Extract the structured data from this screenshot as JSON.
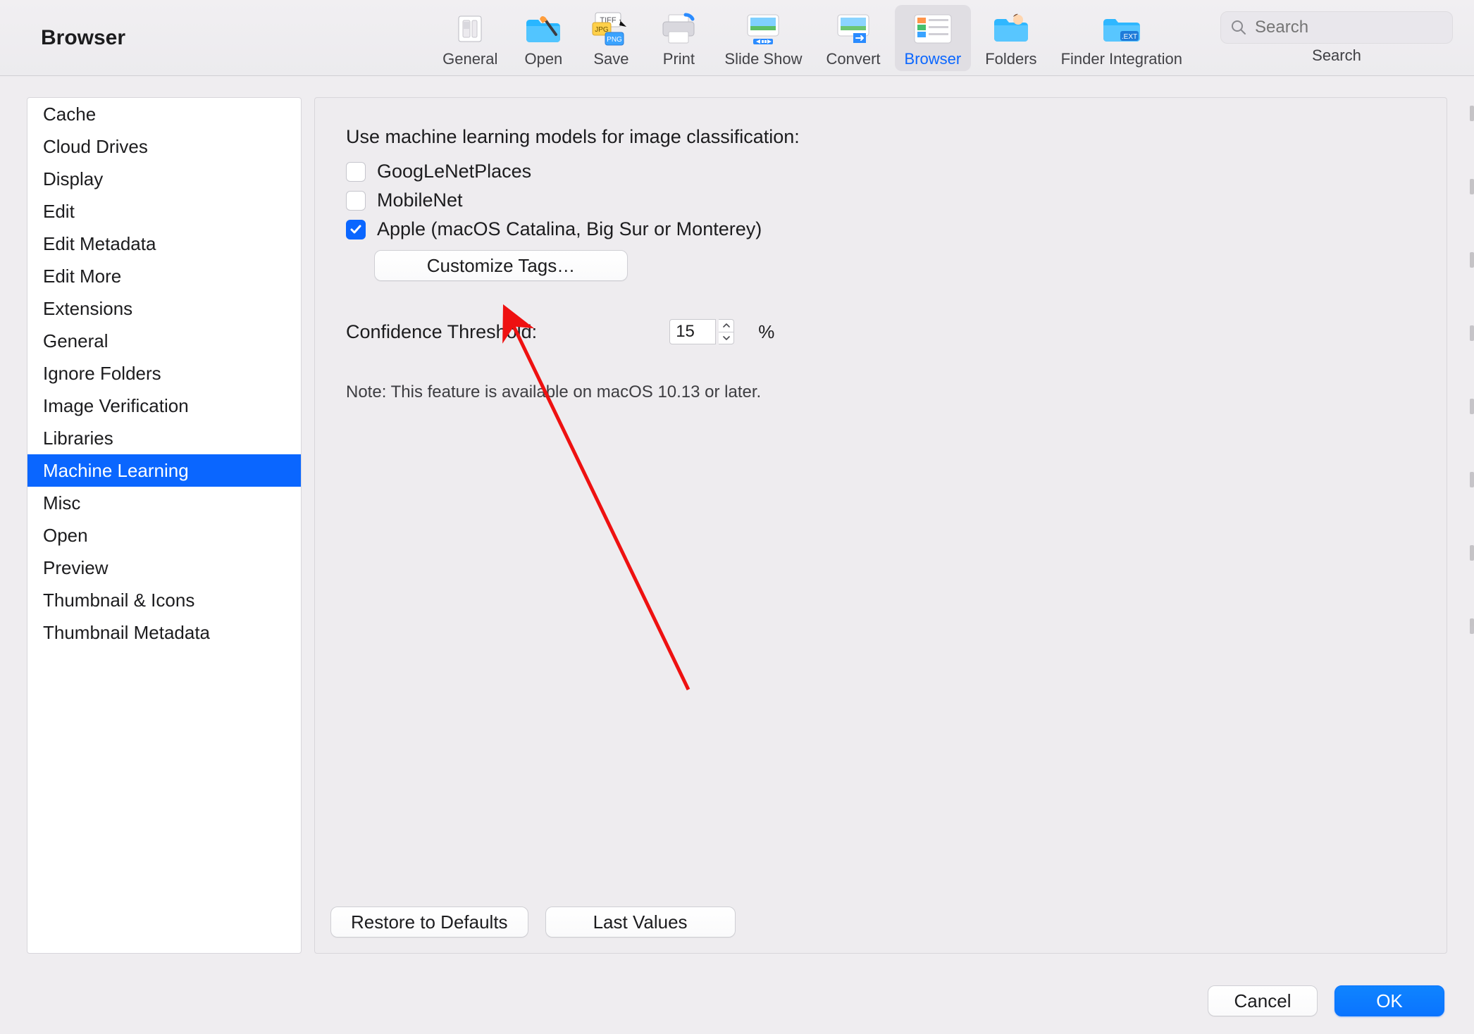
{
  "window": {
    "title": "Browser"
  },
  "toolbar": {
    "items": [
      {
        "label": "General"
      },
      {
        "label": "Open"
      },
      {
        "label": "Save"
      },
      {
        "label": "Print"
      },
      {
        "label": "Slide Show"
      },
      {
        "label": "Convert"
      },
      {
        "label": "Browser"
      },
      {
        "label": "Folders"
      },
      {
        "label": "Finder Integration"
      }
    ],
    "selected_index": 6,
    "search": {
      "placeholder": "Search",
      "label": "Search"
    }
  },
  "sidebar": {
    "items": [
      "Cache",
      "Cloud Drives",
      "Display",
      "Edit",
      "Edit Metadata",
      "Edit More",
      "Extensions",
      "General",
      "Ignore Folders",
      "Image Verification",
      "Libraries",
      "Machine Learning",
      "Misc",
      "Open",
      "Preview",
      "Thumbnail & Icons",
      "Thumbnail Metadata"
    ],
    "selected_index": 11
  },
  "content": {
    "heading": "Use machine learning models for image classification:",
    "models": [
      {
        "label": "GoogLeNetPlaces",
        "checked": false
      },
      {
        "label": "MobileNet",
        "checked": false
      },
      {
        "label": "Apple (macOS Catalina, Big Sur or Monterey)",
        "checked": true
      }
    ],
    "customize_button": "Customize Tags…",
    "threshold": {
      "label": "Confidence Threshold:",
      "value": "15",
      "unit": "%"
    },
    "note": "Note: This feature is available on macOS 10.13 or later.",
    "restore_button": "Restore to Defaults",
    "last_values_button": "Last Values"
  },
  "footer": {
    "cancel": "Cancel",
    "ok": "OK"
  },
  "colors": {
    "accent": "#0a66ff",
    "selection": "#0a66ff"
  }
}
